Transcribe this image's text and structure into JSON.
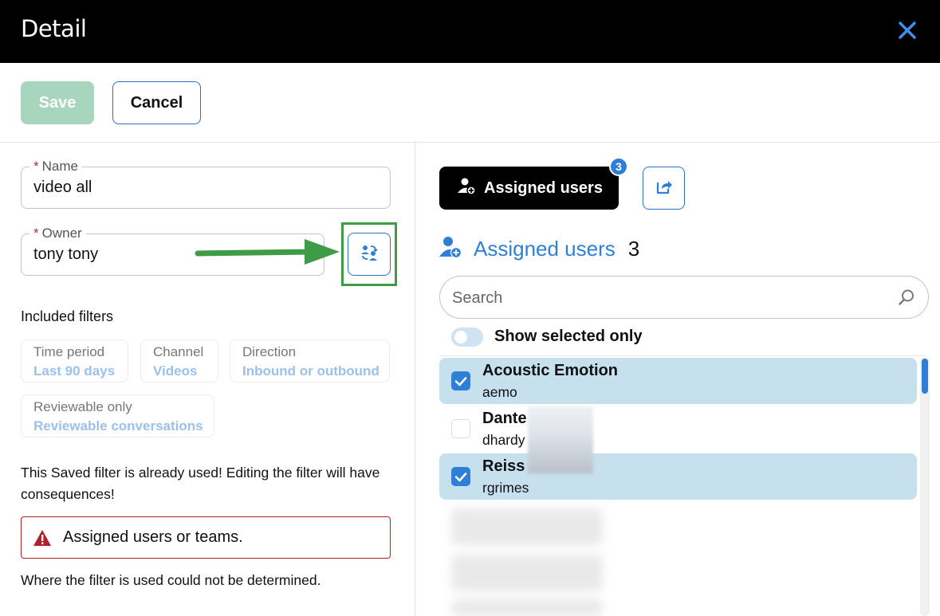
{
  "window": {
    "title": "Detail"
  },
  "toolbar": {
    "save_label": "Save",
    "cancel_label": "Cancel"
  },
  "form": {
    "required_mark": "*",
    "name": {
      "label": "Name",
      "value": "video all"
    },
    "owner": {
      "label": "Owner",
      "value": "tony tony"
    },
    "included_filters_label": "Included filters",
    "filters": [
      {
        "key": "Time period",
        "value": "Last 90 days"
      },
      {
        "key": "Channel",
        "value": "Videos"
      },
      {
        "key": "Direction",
        "value": "Inbound or outbound"
      },
      {
        "key": "Reviewable only",
        "value": "Reviewable conversations"
      }
    ],
    "warning_text": "This Saved filter is already used! Editing the filter will have consequences!",
    "alert_text": "Assigned users or teams.",
    "footer_text": "Where the filter is used could not be determined."
  },
  "right": {
    "tab_label": "Assigned users",
    "badge_count": "3",
    "heading": "Assigned users",
    "heading_count": "3",
    "search_placeholder": "Search",
    "toggle_label": "Show selected only",
    "users": [
      {
        "name": "Acoustic Emotion",
        "username": "aemo",
        "selected": true
      },
      {
        "name": "Dante",
        "username": "dhardy",
        "selected": false
      },
      {
        "name": "Reiss",
        "username": "rgrimes",
        "selected": true
      }
    ]
  },
  "colors": {
    "accent": "#2f7fd7",
    "save_disabled": "#a8d5bd",
    "selected_row": "#c6e0ee",
    "highlight_frame": "#3f9b47",
    "alert_border": "#b3202c"
  },
  "icons": {
    "close": "close-icon",
    "swap_owner": "swap-user-icon",
    "share": "share-icon",
    "add_user": "add-user-icon",
    "search": "search-icon",
    "warning": "warning-icon",
    "check": "check-icon"
  }
}
